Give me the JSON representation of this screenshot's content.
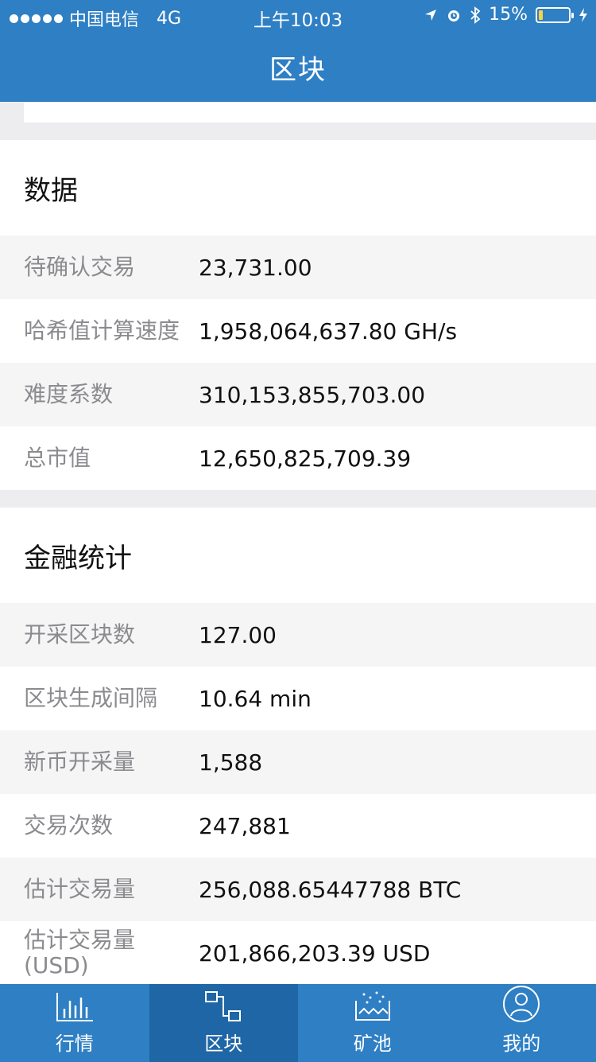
{
  "status_bar": {
    "carrier": "中国电信",
    "network": "4G",
    "time": "上午10:03",
    "battery_percent": "15%",
    "battery_level": 0.15,
    "icons": [
      "location-arrow-icon",
      "alarm-icon",
      "bluetooth-icon",
      "charging-icon"
    ]
  },
  "nav": {
    "title": "区块"
  },
  "sections": [
    {
      "title": "数据",
      "rows": [
        {
          "label": "待确认交易",
          "value": "23,731.00"
        },
        {
          "label": "哈希值计算速度",
          "value": "1,958,064,637.80 GH/s"
        },
        {
          "label": "难度系数",
          "value": "310,153,855,703.00"
        },
        {
          "label": "总市值",
          "value": "12,650,825,709.39"
        }
      ]
    },
    {
      "title": "金融统计",
      "rows": [
        {
          "label": "开采区块数",
          "value": "127.00"
        },
        {
          "label": "区块生成间隔",
          "value": "10.64 min"
        },
        {
          "label": "新币开采量",
          "value": "1,588"
        },
        {
          "label": "交易次数",
          "value": "247,881"
        },
        {
          "label": "估计交易量",
          "value": "256,088.65447788 BTC"
        },
        {
          "label": "估计交易量(USD)",
          "value": "201,866,203.39 USD"
        }
      ]
    }
  ],
  "tabbar": {
    "items": [
      {
        "label": "行情",
        "icon": "bar-chart-icon",
        "active": false
      },
      {
        "label": "区块",
        "icon": "block-flow-icon",
        "active": true
      },
      {
        "label": "矿池",
        "icon": "mining-pool-icon",
        "active": false
      },
      {
        "label": "我的",
        "icon": "user-profile-icon",
        "active": false
      }
    ]
  },
  "colors": {
    "brand": "#2e7fc4",
    "tab_active": "#1f66a6",
    "label": "#8b8b8f"
  }
}
